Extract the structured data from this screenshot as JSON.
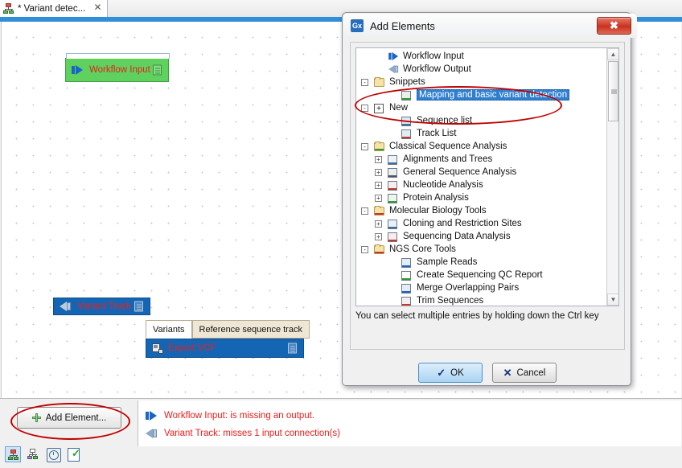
{
  "tab": {
    "title": "* Variant detec...",
    "close_label": "✕",
    "icon": "workflow-icon"
  },
  "canvas": {
    "nodes": [
      {
        "id": "workflow-input",
        "label": "Workflow Input",
        "icon": "arrow-in-icon",
        "doc_icon": "document-icon",
        "color": "#5fd15f"
      },
      {
        "id": "variant-track",
        "label": "Variant Track",
        "icon": "arrow-out-icon",
        "doc_icon": "document-icon",
        "color": "#1466b5"
      },
      {
        "id": "export-vcf",
        "label": "Export VCF",
        "icon": "export-icon",
        "doc_icon": "document-icon",
        "color": "#1466b5"
      }
    ],
    "port_tabs": [
      {
        "label": "Variants",
        "selected": true
      },
      {
        "label": "Reference sequence track",
        "selected": false
      }
    ]
  },
  "bottom": {
    "add_element_label": "Add Element...",
    "add_element_icon": "plus-icon",
    "messages": [
      {
        "icon": "arrow-in-icon",
        "text": "Workflow Input: is missing an output."
      },
      {
        "icon": "arrow-out-icon",
        "text": "Variant Track: misses 1 input connection(s)"
      }
    ],
    "toolbar_icons": [
      "workflow-design-icon",
      "workflow-run-icon",
      "history-icon",
      "validate-icon"
    ]
  },
  "dialog": {
    "title": "Add Elements",
    "app_badge": "Gx",
    "close_label": "✖",
    "hint": "You can select multiple entries by holding down the Ctrl key",
    "ok_label": "OK",
    "ok_mark": "✓",
    "cancel_label": "Cancel",
    "cancel_mark": "✕",
    "scrollbar": {
      "up": "▲",
      "down": "▼"
    },
    "tree": [
      {
        "label": "Workflow Input",
        "depth": 1,
        "toggle": "",
        "icon": "arrow-in-icon",
        "selected": false
      },
      {
        "label": "Workflow Output",
        "depth": 1,
        "toggle": "",
        "icon": "arrow-out-icon",
        "selected": false
      },
      {
        "label": "Snippets",
        "depth": 0,
        "toggle": "-",
        "icon": "folder-icon",
        "selected": false
      },
      {
        "label": "Mapping and basic variant detection",
        "depth": 2,
        "toggle": "",
        "icon": "snippet-icon",
        "selected": true
      },
      {
        "label": "New",
        "depth": 0,
        "toggle": "-",
        "icon": "new-icon",
        "selected": false
      },
      {
        "label": "Sequence list",
        "depth": 2,
        "toggle": "",
        "icon": "sequence-list-icon",
        "selected": false
      },
      {
        "label": "Track List",
        "depth": 2,
        "toggle": "",
        "icon": "track-list-icon",
        "selected": false
      },
      {
        "label": "Classical Sequence Analysis",
        "depth": 0,
        "toggle": "-",
        "icon": "folder-chart-icon",
        "selected": false
      },
      {
        "label": "Alignments and Trees",
        "depth": 1,
        "toggle": "+",
        "icon": "alignment-icon",
        "selected": false
      },
      {
        "label": "General Sequence Analysis",
        "depth": 1,
        "toggle": "+",
        "icon": "general-seq-icon",
        "selected": false
      },
      {
        "label": "Nucleotide Analysis",
        "depth": 1,
        "toggle": "+",
        "icon": "nucleotide-icon",
        "selected": false
      },
      {
        "label": "Protein Analysis",
        "depth": 1,
        "toggle": "+",
        "icon": "protein-icon",
        "selected": false
      },
      {
        "label": "Molecular Biology Tools",
        "depth": 0,
        "toggle": "-",
        "icon": "molbio-icon",
        "selected": false
      },
      {
        "label": "Cloning and Restriction Sites",
        "depth": 1,
        "toggle": "+",
        "icon": "cloning-icon",
        "selected": false
      },
      {
        "label": "Sequencing Data Analysis",
        "depth": 1,
        "toggle": "+",
        "icon": "seqdata-icon",
        "selected": false
      },
      {
        "label": "NGS Core Tools",
        "depth": 0,
        "toggle": "-",
        "icon": "ngs-icon",
        "selected": false
      },
      {
        "label": "Sample Reads",
        "depth": 2,
        "toggle": "",
        "icon": "sample-reads-icon",
        "selected": false
      },
      {
        "label": "Create Sequencing QC Report",
        "depth": 2,
        "toggle": "",
        "icon": "qc-report-icon",
        "selected": false
      },
      {
        "label": "Merge Overlapping Pairs",
        "depth": 2,
        "toggle": "",
        "icon": "merge-pairs-icon",
        "selected": false
      },
      {
        "label": "Trim Sequences",
        "depth": 2,
        "toggle": "",
        "icon": "trim-icon",
        "selected": false
      }
    ]
  },
  "annotations": {
    "highlight_snippets": "red-ellipse",
    "highlight_add_element": "red-ellipse"
  },
  "colors": {
    "accent_blue": "#2f8fd8",
    "node_green": "#5fd15f",
    "node_blue": "#1466b5",
    "label_red": "#e8201c",
    "annotation_red": "#c00000",
    "selection_blue": "#2f7fd0"
  }
}
